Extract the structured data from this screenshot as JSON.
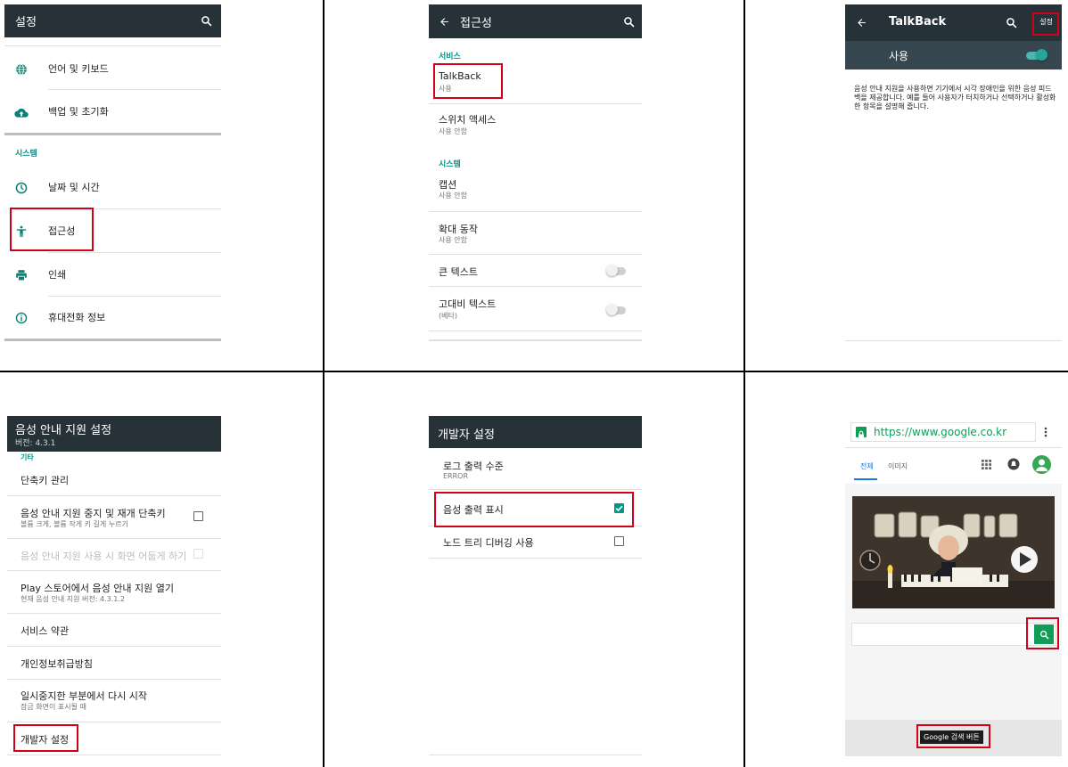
{
  "panel1": {
    "title": "설정",
    "items_top": [
      {
        "icon": "globe-icon",
        "label": "언어 및 키보드"
      },
      {
        "icon": "cloud-upload-icon",
        "label": "백업 및 초기화"
      }
    ],
    "section": "시스템",
    "items_system": [
      {
        "icon": "clock-icon",
        "label": "날짜 및 시간"
      },
      {
        "icon": "accessibility-icon",
        "label": "접근성"
      },
      {
        "icon": "print-icon",
        "label": "인쇄"
      },
      {
        "icon": "info-icon",
        "label": "휴대전화 정보"
      }
    ]
  },
  "panel2": {
    "title": "접근성",
    "section_services": "서비스",
    "talkback": {
      "label": "TalkBack",
      "status": "사용"
    },
    "switch_access": {
      "label": "스위치 액세스",
      "status": "사용 안함"
    },
    "section_system": "시스템",
    "captions": {
      "label": "캡션",
      "status": "사용 안함"
    },
    "magnification": {
      "label": "확대 동작",
      "status": "사용 안함"
    },
    "large_text": {
      "label": "큰 텍스트",
      "on": false
    },
    "high_contrast": {
      "label": "고대비 텍스트",
      "sub": "(베타)",
      "on": false
    }
  },
  "panel3": {
    "title": "TalkBack",
    "settings_label": "설정",
    "toggle_label": "사용",
    "toggle_on": true,
    "description": "음성 안내 지원을 사용하면 기기에서 시각 장애인을 위한 음성 피드백을 제공합니다. 예를 들어 사용자가 터치하거나 선택하거나 활성화한 항목을 설명해 줍니다."
  },
  "panel4": {
    "title": "음성 안내 지원 설정",
    "version": "버전: 4.3.1",
    "section": "기타",
    "items": [
      {
        "label": "단축키 관리",
        "sub": ""
      },
      {
        "label": "음성 안내 지원 중지 및 재개 단축키",
        "sub": "볼륨 크게, 볼륨 작게 키 길게 누르기",
        "checkbox": "unchecked"
      },
      {
        "label": "음성 안내 지원 사용 시 화면 어둡게 하기",
        "sub": "",
        "checkbox": "disabled"
      },
      {
        "label": "Play 스토어에서 음성 안내 지원 열기",
        "sub": "현재 음성 안내 지원 버전: 4.3.1.2"
      },
      {
        "label": "서비스 약관",
        "sub": ""
      },
      {
        "label": "개인정보취급방침",
        "sub": ""
      },
      {
        "label": "일시중지한 부분에서 다시 시작",
        "sub": "잠금 화면이 표시될 때"
      },
      {
        "label": "개발자 설정",
        "sub": ""
      }
    ]
  },
  "panel5": {
    "title": "개발자 설정",
    "log_level": {
      "label": "로그 출력 수준",
      "value": "ERROR"
    },
    "show_speech": {
      "label": "음성 출력 표시",
      "checked": true
    },
    "node_tree": {
      "label": "노드 트리 디버깅 사용",
      "checked": false
    }
  },
  "panel6": {
    "url": "https://www.google.co.kr",
    "tabs": [
      "전체",
      "이미지"
    ],
    "search_placeholder": "",
    "caption": "Google 검색 버튼",
    "accent": "#0f9d58"
  }
}
